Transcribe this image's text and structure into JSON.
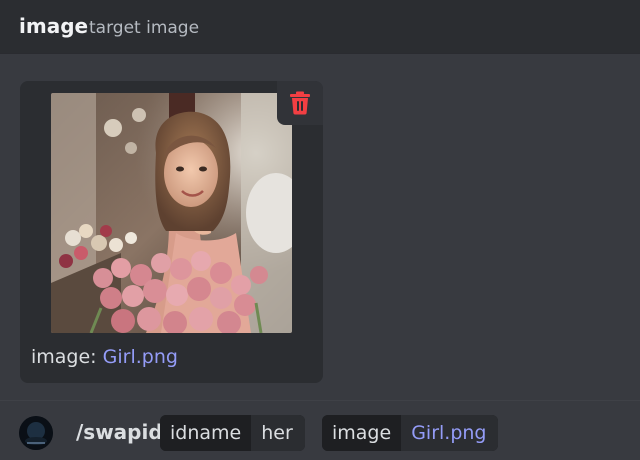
{
  "header": {
    "title": "image",
    "subtitle": "target image"
  },
  "attachment": {
    "caption_key": "image:",
    "caption_value": "Girl.png",
    "delete_icon": "trash-icon",
    "delete_color": "#f23f43"
  },
  "command": {
    "name": "/swapid",
    "options": [
      {
        "key": "idname",
        "value": "her"
      },
      {
        "key": "image",
        "value": "Girl.png"
      }
    ]
  },
  "colors": {
    "background": "#383a40",
    "header": "#2b2d31",
    "link": "#949cf7"
  }
}
